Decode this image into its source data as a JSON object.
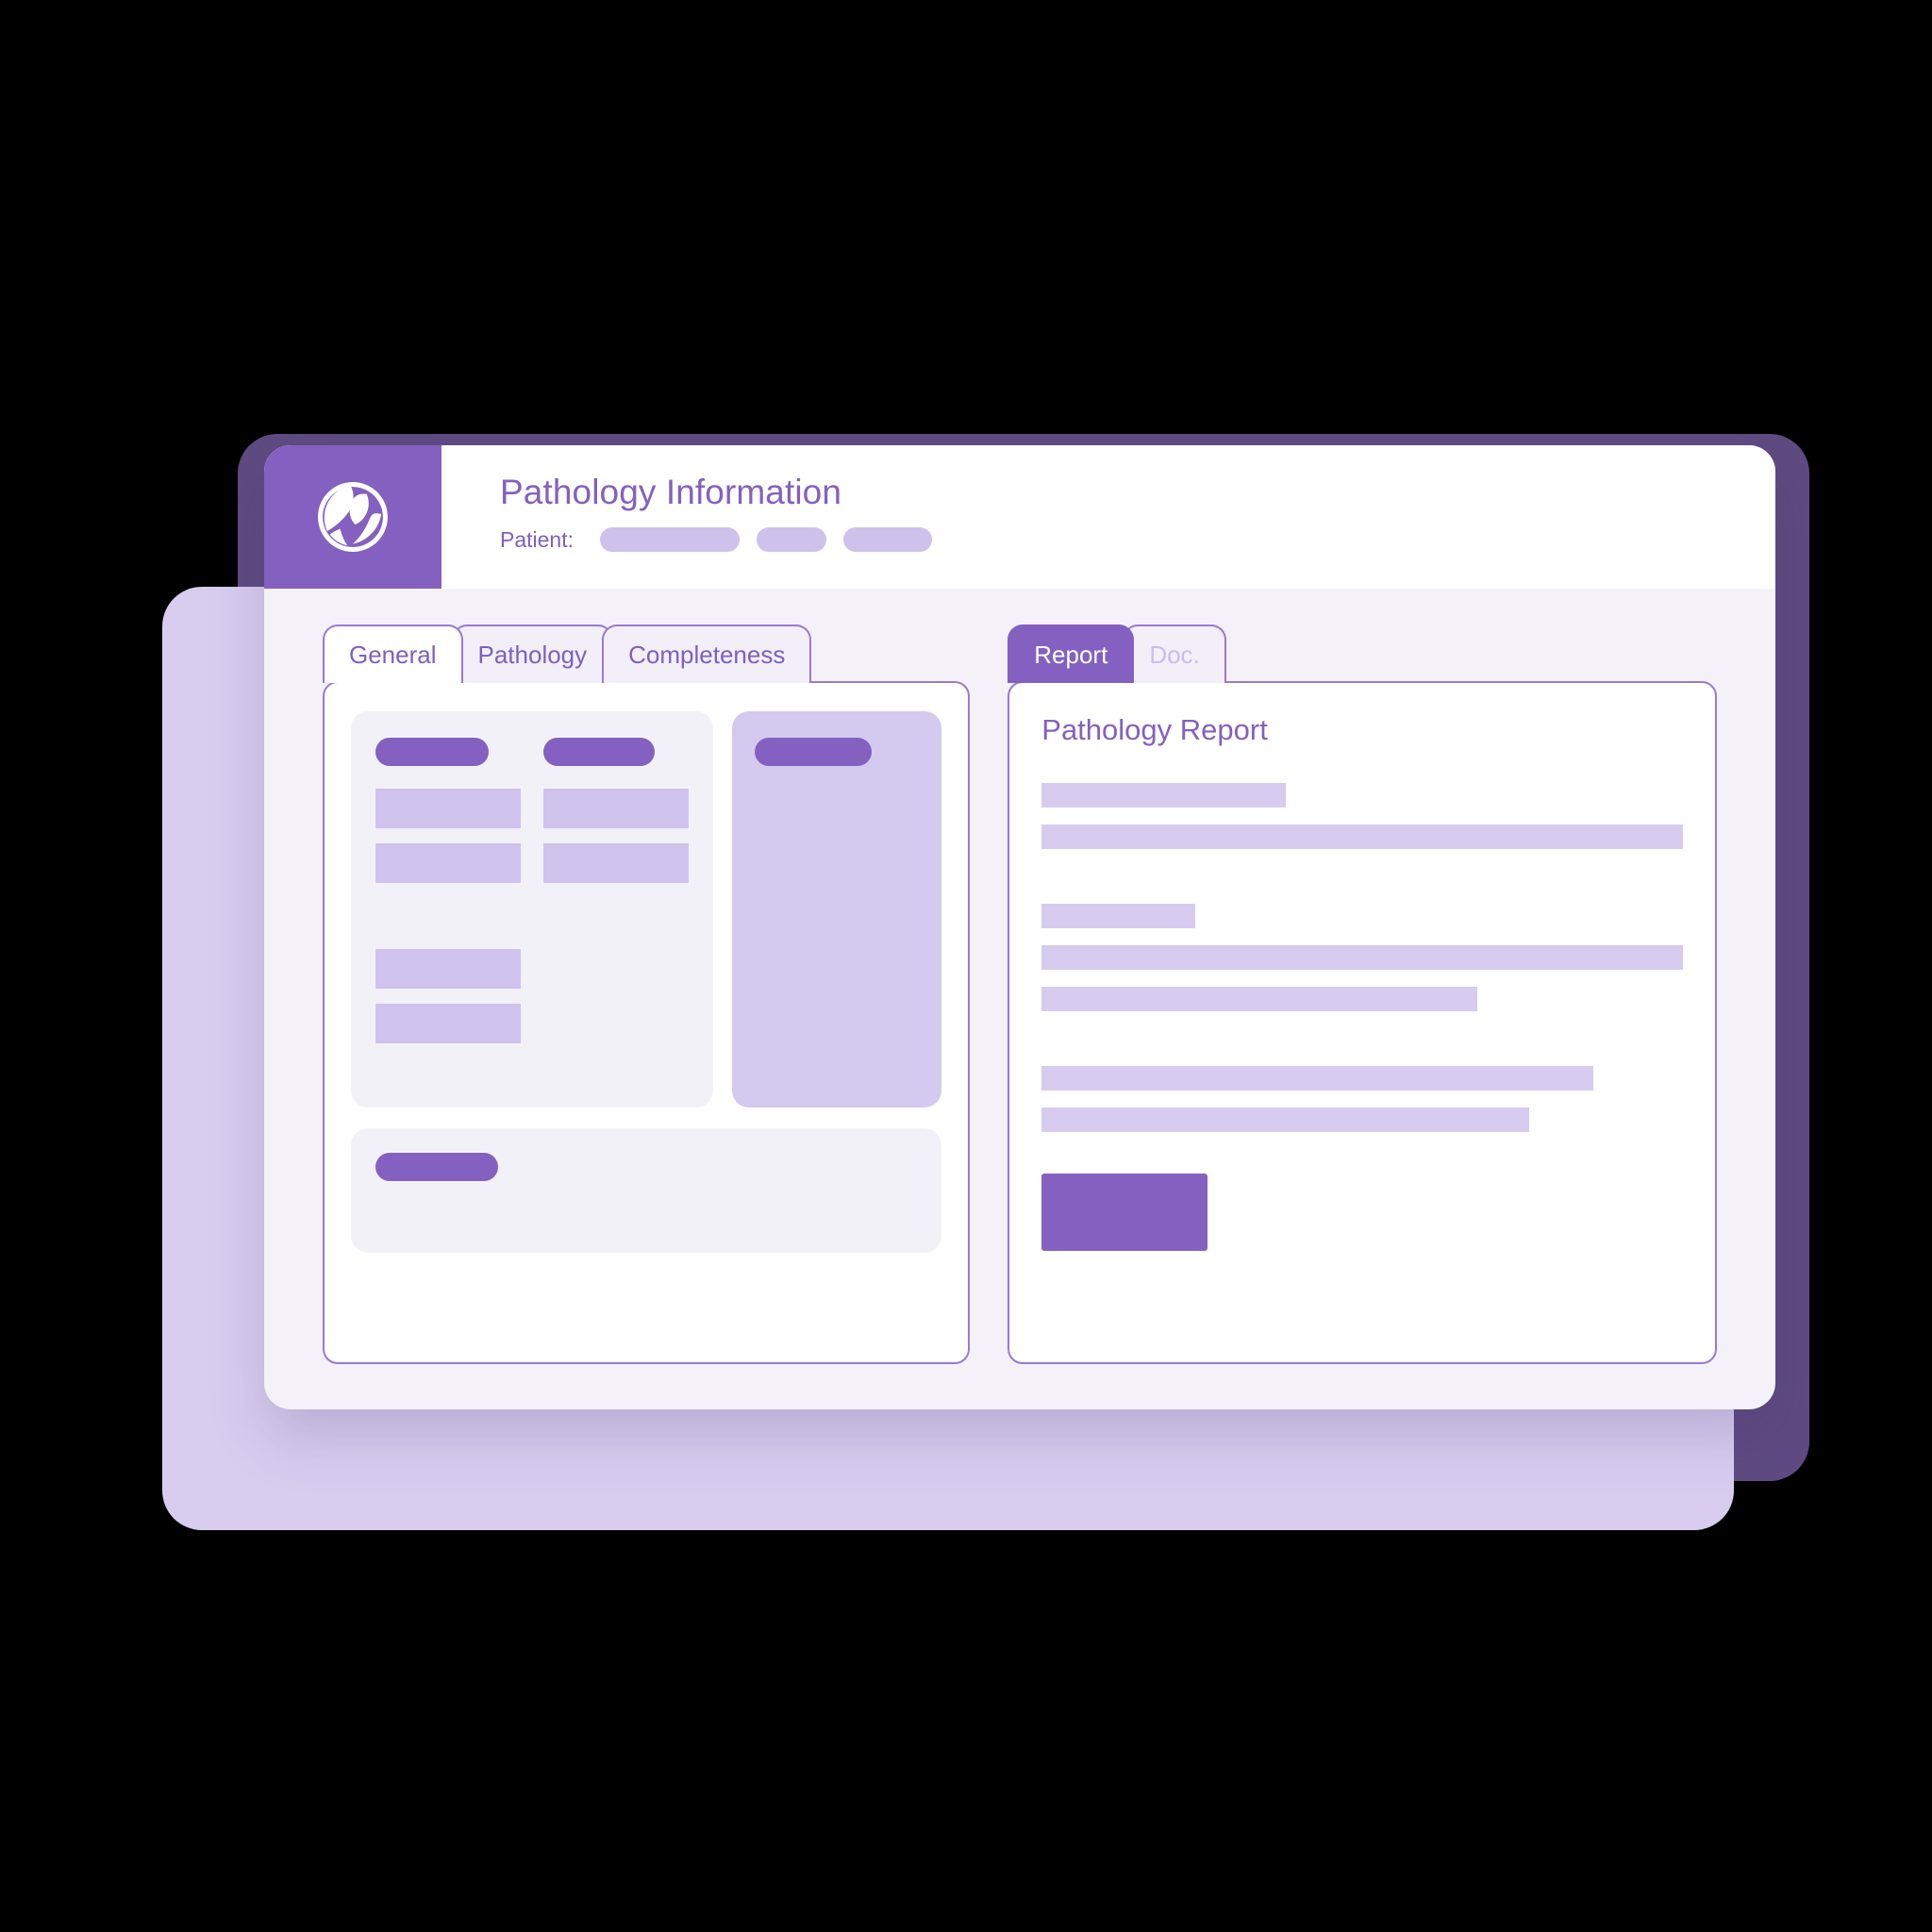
{
  "app": {
    "title": "Pathology Information",
    "logo_icon": "globe-leaf-logo-icon"
  },
  "patient": {
    "label": "Patient:",
    "redacted_values": [
      "",
      "",
      ""
    ]
  },
  "left_panel": {
    "tabs": [
      {
        "label": "General",
        "state": "active"
      },
      {
        "label": "Pathology",
        "state": "inactive"
      },
      {
        "label": "Completeness",
        "state": "inactive"
      }
    ],
    "fields_card": {
      "columns": [
        {
          "heading_placeholder": "",
          "value_placeholders": [
            "",
            "",
            "",
            ""
          ]
        },
        {
          "heading_placeholder": "",
          "value_placeholders": [
            "",
            ""
          ]
        }
      ]
    },
    "side_card": {
      "heading_placeholder": ""
    },
    "bottom_card": {
      "heading_placeholder": ""
    }
  },
  "right_panel": {
    "tabs": [
      {
        "label": "Report",
        "state": "active"
      },
      {
        "label": "Doc.",
        "state": "inactive"
      }
    ],
    "report": {
      "title": "Pathology Report",
      "paragraphs": [
        {
          "lines": [
            38,
            100
          ]
        },
        {
          "lines": [
            24,
            100,
            68
          ]
        },
        {
          "lines": [
            86,
            76
          ]
        }
      ],
      "action_button_label": ""
    }
  },
  "colors": {
    "brand_purple": "#8460c0",
    "brand_purple_dark": "#5f4b82",
    "lavender": "#d4c9ef",
    "lavender_light": "#d8cdef",
    "skeleton": "#cfc3ed",
    "panel_bg": "#f4f2f8",
    "card_soft": "#f3f1f8",
    "border_purple": "#9a79d4",
    "text_purple": "#7f5fbe",
    "muted_tab": "#cbbdea",
    "canvas": "#000000"
  }
}
